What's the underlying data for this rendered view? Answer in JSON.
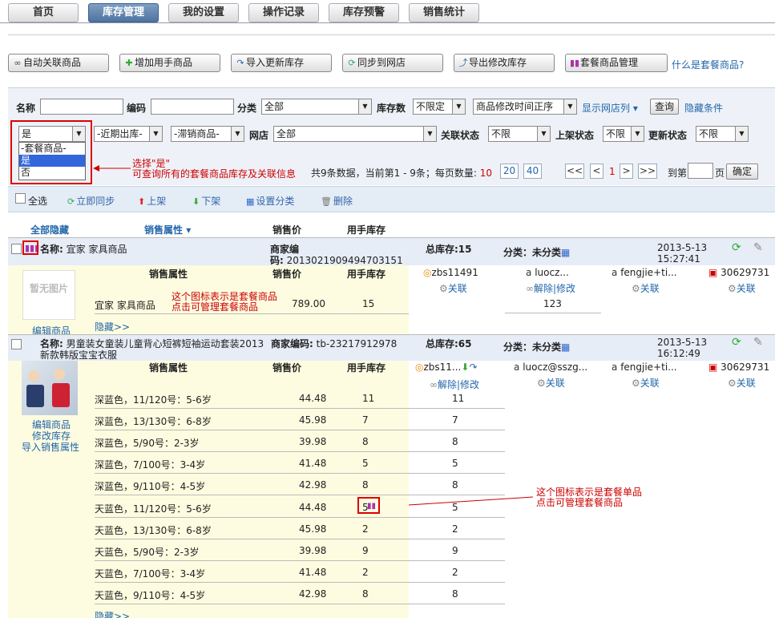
{
  "tabs": [
    "首页",
    "库存管理",
    "我的设置",
    "操作记录",
    "库存预警",
    "销售统计"
  ],
  "toolbar": {
    "b1": "自动关联商品",
    "b2": "增加用手商品",
    "b3": "导入更新库存",
    "b4": "同步到网店",
    "b5": "导出修改库存",
    "b6": "套餐商品管理",
    "help": "什么是套餐商品?"
  },
  "filter": {
    "name_lbl": "名称",
    "code_lbl": "编码",
    "cat_lbl": "分类",
    "cat_val": "全部",
    "stock_lbl": "库存数",
    "stock_val": "不限定",
    "sort_val": "商品修改时间正序",
    "show_shops": "显示网店列",
    "query": "查询",
    "hide": "隐藏条件",
    "combo_val": "是",
    "recent_val": "-近期出库-",
    "slow_val": "-滞销商品-",
    "shop_lbl": "网店",
    "shop_val": "全部",
    "rel_lbl": "关联状态",
    "rel_val": "不限",
    "shelf_lbl": "上架状态",
    "shelf_val": "不限",
    "upd_lbl": "更新状态",
    "upd_val": "不限",
    "dropdown": [
      "-套餐商品-",
      "是",
      "否"
    ]
  },
  "annotations": {
    "a1_l1": "选择\"是\"",
    "a1_l2": "可查询所有的套餐商品库存及关联信息",
    "a2_l1": "这个图标表示是套餐商品",
    "a2_l2": "点击可管理套餐商品",
    "a3_l1": "这个图标表示是套餐单品",
    "a3_l2": "点击可管理套餐商品"
  },
  "pager": {
    "info_pre": "共9条数据，当前第1 - 9条；每页数量:",
    "cur_size": "10",
    "s20": "20",
    "s40": "40",
    "first": "<<",
    "prev": "<",
    "page": "1",
    "next": ">",
    "last": ">>",
    "goto": "到第",
    "pg": "页",
    "ok": "确定"
  },
  "actions": {
    "all": "全选",
    "sync": "立即同步",
    "up": "上架",
    "down": "下架",
    "setcat": "设置分类",
    "del": "删除"
  },
  "listhdr": {
    "hideall": "全部隐藏",
    "attr": "销售属性",
    "price": "销售价",
    "stock": "用手库存"
  },
  "p1": {
    "name_lbl": "名称:",
    "name": "宜家 家具商品",
    "code_lbl1": "商家编",
    "code_lbl2": "码:",
    "code": "2013021909494703151",
    "total": "总库存:15",
    "cat": "分类：未分类",
    "date": "2013-5-13",
    "time": "15:27:41",
    "noimg": "暂无图片",
    "edit": "编辑商品",
    "hide": "隐藏>>",
    "h_attr": "销售属性",
    "h_price": "销售价",
    "h_stock": "用手库存",
    "row_attr": "宜家 家具商品",
    "row_price": "789.00",
    "row_stock": "15",
    "s1": "zbs11491",
    "s1a": "关联",
    "s2": "luocz...",
    "s2a": "解除|修改",
    "s2v": "123",
    "s3": "fengjie+ti...",
    "s3a": "关联",
    "s4": "30629731",
    "s4a": "关联"
  },
  "p2": {
    "name_lbl": "名称:",
    "name1": "男童装女童装儿童背心短裤短袖运动套装2013",
    "name2": "新款韩版宝宝衣服",
    "code_lbl": "商家编码:",
    "code": "tb-23217912978",
    "total": "总库存:65",
    "cat": "分类：未分类",
    "date": "2013-5-13",
    "time": "16:12:49",
    "edit": "编辑商品",
    "editstock": "修改库存",
    "import": "导入销售属性",
    "hide": "隐藏>>",
    "h_attr": "销售属性",
    "h_price": "销售价",
    "h_stock": "用手库存",
    "s1": "zbs11...",
    "s1a": "解除|修改",
    "s2": "luocz@sszg...",
    "s2a": "关联",
    "s3": "fengjie+ti...",
    "s3a": "关联",
    "s4": "30629731",
    "s4a": "关联",
    "rows": [
      {
        "attr": "深蓝色，11/120号：5-6岁",
        "price": "44.48",
        "stock": "11",
        "sync": "11"
      },
      {
        "attr": "深蓝色，13/130号：6-8岁",
        "price": "45.98",
        "stock": "7",
        "sync": "7"
      },
      {
        "attr": "深蓝色，5/90号：2-3岁",
        "price": "39.98",
        "stock": "8",
        "sync": "8"
      },
      {
        "attr": "深蓝色，7/100号：3-4岁",
        "price": "41.48",
        "stock": "5",
        "sync": "5"
      },
      {
        "attr": "深蓝色，9/110号：4-5岁",
        "price": "42.98",
        "stock": "8",
        "sync": "8"
      },
      {
        "attr": "天蓝色，11/120号：5-6岁",
        "price": "44.48",
        "stock": "5",
        "sync": "5"
      },
      {
        "attr": "天蓝色，13/130号：6-8岁",
        "price": "45.98",
        "stock": "2",
        "sync": "2"
      },
      {
        "attr": "天蓝色，5/90号：2-3岁",
        "price": "39.98",
        "stock": "9",
        "sync": "9"
      },
      {
        "attr": "天蓝色，7/100号：3-4岁",
        "price": "41.48",
        "stock": "2",
        "sync": "2"
      },
      {
        "attr": "天蓝色，9/110号：4-5岁",
        "price": "42.98",
        "stock": "8",
        "sync": "8"
      }
    ]
  }
}
